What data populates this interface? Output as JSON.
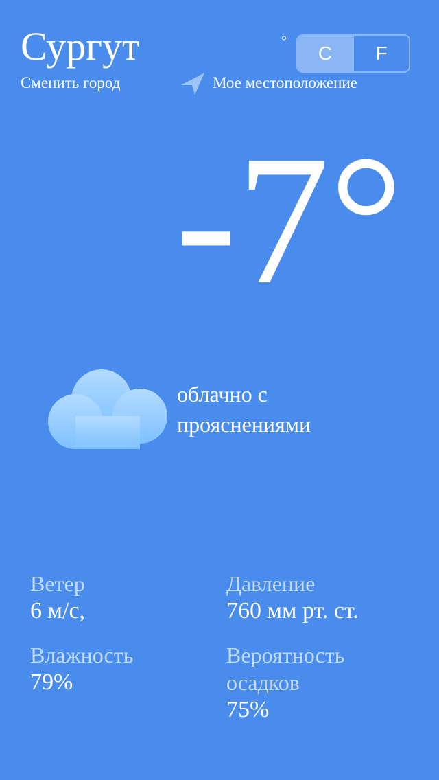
{
  "header": {
    "city": "Сургут",
    "change_city_label": "Сменить город",
    "my_location_label": "Мое местоположение",
    "location_icon": "location-arrow-icon"
  },
  "units": {
    "degree_symbol": "°",
    "celsius_label": "C",
    "fahrenheit_label": "F",
    "selected": "C"
  },
  "current": {
    "temperature": "-7°",
    "description": "облачно с прояснениями",
    "icon": "cloud-icon"
  },
  "stats": {
    "wind": {
      "label": "Ветер",
      "value": "6 м/с,"
    },
    "pressure": {
      "label": "Давление",
      "value": "760 мм рт. ст."
    },
    "humidity": {
      "label": "Влажность",
      "value": "79%"
    },
    "precipitation": {
      "label": "Вероятность осадков",
      "value": "75%"
    }
  },
  "colors": {
    "background": "#498cec",
    "secondary_text": "#c2dbfb",
    "switch_active": "#8ab6f4",
    "cloud_top": "#b3dbff",
    "cloud_bottom": "#7ec1ff"
  }
}
